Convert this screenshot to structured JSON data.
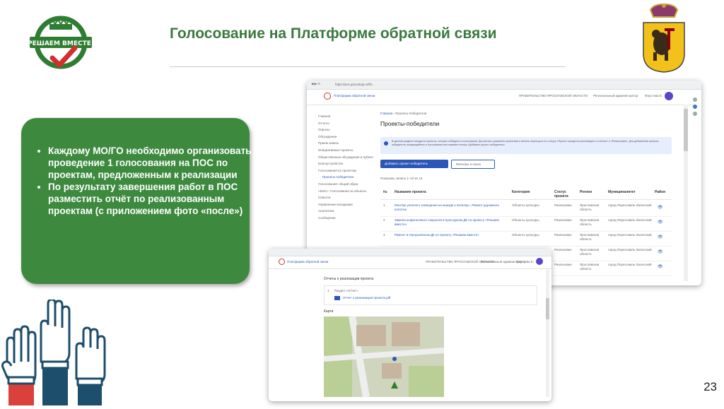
{
  "header": {
    "title": "Голосование на Платформе обратной связи",
    "logo_text": "РЕШАЕМ ВМЕСТЕ!"
  },
  "card": {
    "bullets": [
      "Каждому МО/ГО необходимо организовать проведение 1 голосования на ПОС по проектам, предложенным к реализации",
      "По результату завершения работ в ПОС разместить отчёт по реализованным проектам (с приложением фото «после»)"
    ]
  },
  "screen1": {
    "url": "https://pos.gosuslugi.ru/lk/...",
    "app_title": "Платформа обратной связи",
    "org": "ПРАВИТЕЛЬСТВО ЯРОСЛАВСКОЙ ОБЛАСТИ",
    "user_role": "Региональный администратор",
    "user_name": "Фаустова Е.",
    "breadcrumb": [
      "Главная",
      "Проекты-победители"
    ],
    "page_title": "Проекты-победители",
    "info_text": "В данном разделе находятся проекты, которые победили в голосовании. Достаточно управлять проектами и менять переход их по статусу «Проект находится реализация и отчетом» и «Реализован». Для добавления проекта-победителя, возвращайтесь в голосования или нажмите кнопку «Добавить проект-победитель».",
    "add_button": "Добавить проект-победитель",
    "filter_button": "Фильтры и поиск",
    "shown_count": "Показаны записи 1–10 из 13",
    "sidebar": [
      "Главная",
      "Отчеты",
      "Опросы",
      "Обсуждения",
      "Прием заявок",
      "Инициативные проекты",
      "Общественные обсуждения и публичные слушания",
      "Благоустройство",
      "Голосования по проектам",
      "Проекты-победители",
      "Голосования: общий образ",
      "«ЕИС»: Голосования за объекты",
      "Новости",
      "Управление вкладками",
      "Аналитика",
      "Сообщения"
    ],
    "columns": [
      "№",
      "Название проекта",
      "Категория",
      "Статус проекта",
      "Регион",
      "Муниципалитет",
      "Район"
    ],
    "rows": [
      {
        "n": "1",
        "name": "Монтаж уличного освещения на выезде к поселку», Ремонт дорожного полотна",
        "cat": "Объекты культуры",
        "status": "Реализован",
        "region": "Ярославская область",
        "mun": "город Переславль-Залесский"
      },
      {
        "n": "2",
        "name": "Замена асфальтового покрытия в Культурном ДК по проекту «Решаем вместе»",
        "cat": "Объекты культуры",
        "status": "Реализован",
        "region": "Ярославская область",
        "mun": "город Переславль-Залесский"
      },
      {
        "n": "3",
        "name": "Ремонт в Нагорьевском ДК по проекту «Решаем вместе»",
        "cat": "Объекты культуры",
        "status": "Реализован",
        "region": "Ярославская область",
        "mun": "город Переславль-Залесский"
      },
      {
        "n": "4",
        "name": "",
        "cat": "",
        "status": "Реализован",
        "region": "Ярославская область",
        "mun": "город Переславль-Залесский"
      },
      {
        "n": "5",
        "name": "",
        "cat": "",
        "status": "Реализован",
        "region": "Ярославская область",
        "mun": "город Переславль-Залесский"
      }
    ]
  },
  "screen2": {
    "app_title": "Платформа обратной связи",
    "org": "ПРАВИТЕЛЬСТВО ЯРОСЛАВСКОЙ ОБЛАСТИ",
    "user_role": "Региональный администратор",
    "user_name": "Фаустова Е.",
    "section_title": "Отчеты о реализации проекта",
    "item_label": "Раздел «Отчет»",
    "file_name": "Отчет о реализации проекта.pdf",
    "map_label": "Карта"
  },
  "page_number": "23",
  "colors": {
    "title_green": "#3a7a3e",
    "card_green": "#3d8a3f",
    "link_blue": "#2a57b8",
    "hands_navy": "#1d4e6b",
    "hands_red": "#d9413a"
  }
}
